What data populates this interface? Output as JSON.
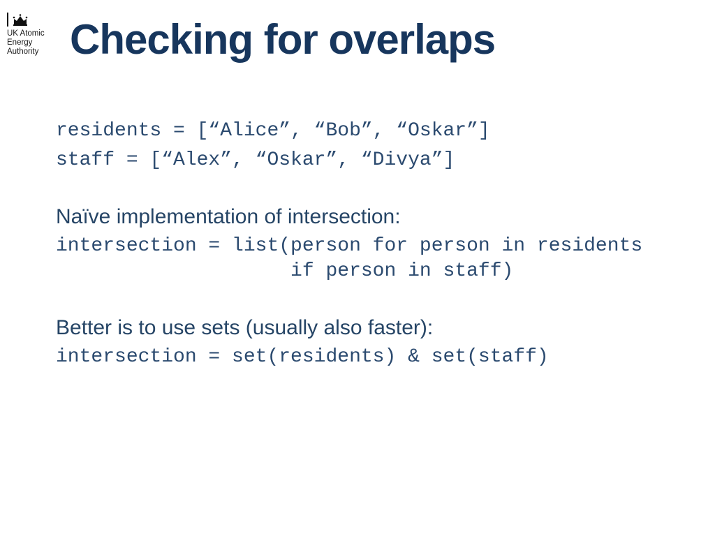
{
  "logo": {
    "org_line1": "UK Atomic",
    "org_line2": "Energy",
    "org_line3": "Authority"
  },
  "title": "Checking for overlaps",
  "body": {
    "code_block1_line1": "residents = [“Alice”, “Bob”, “Oskar”]",
    "code_block1_line2": "staff = [“Alex”, “Oskar”, “Divya”]",
    "prose1": "Naïve implementation of intersection:",
    "code_block2_line1": "intersection = list(person for person in residents",
    "code_block2_line2": "                    if person in staff)",
    "prose2": "Better is to use sets (usually also faster):",
    "code_block3_line1": "intersection = set(residents) & set(staff)"
  }
}
